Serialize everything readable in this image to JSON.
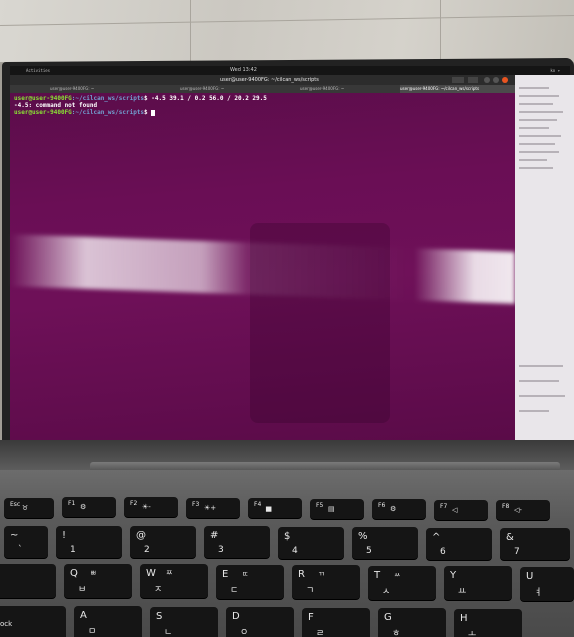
{
  "topbar": {
    "title": "Wed 13:42",
    "indicators": "ko  ▾"
  },
  "window": {
    "title": "user@user-9400FG: ~/cilcan_ws/scripts"
  },
  "tabs": [
    {
      "label": "user@user-9400FG: ~"
    },
    {
      "label": "user@user-9400FG: ~"
    },
    {
      "label": "user@user-9400FG: ~"
    },
    {
      "label": "user@user-9400FG: ~/cilcan_ws/scripts"
    }
  ],
  "terminal": {
    "line1_user": "user@user-9400FG",
    "line1_path": ":~/cilcan_ws/scripts",
    "line1_cmd": "$ -4.5 39.1 / 0.2 56.0 / 20.2 29.5",
    "line2": "-4.5: command not found",
    "line3_user": "user@user-9400FG",
    "line3_path": ":~/cilcan_ws/scripts",
    "line3_cmd": "$ "
  },
  "keyboard": {
    "fkeys": [
      {
        "main": "Esc",
        "sub": "♉"
      },
      {
        "main": "F1",
        "sub": "⚙"
      },
      {
        "main": "F2",
        "sub": "☀-"
      },
      {
        "main": "F3",
        "sub": "☀+"
      },
      {
        "main": "F4",
        "sub": "▅"
      },
      {
        "main": "F5",
        "sub": "▤"
      },
      {
        "main": "F6",
        "sub": "⚙"
      },
      {
        "main": "F7",
        "sub": "◁"
      },
      {
        "main": "F8",
        "sub": "◁-"
      }
    ],
    "numbers": [
      {
        "main": "~",
        "sub": "`"
      },
      {
        "main": "!",
        "sub": "1"
      },
      {
        "main": "@",
        "sub": "2"
      },
      {
        "main": "#",
        "sub": "3"
      },
      {
        "main": "$",
        "sub": "4"
      },
      {
        "main": "%",
        "sub": "5"
      },
      {
        "main": "^",
        "sub": "6"
      },
      {
        "main": "&",
        "sub": "7"
      }
    ],
    "qwerty": [
      {
        "main": "Q",
        "ko": "ㅃ",
        "sub": "ㅂ"
      },
      {
        "main": "W",
        "ko": "ㅉ",
        "sub": "ㅈ"
      },
      {
        "main": "E",
        "ko": "ㄸ",
        "sub": "ㄷ"
      },
      {
        "main": "R",
        "ko": "ㄲ",
        "sub": "ㄱ"
      },
      {
        "main": "T",
        "ko": "ㅆ",
        "sub": "ㅅ"
      },
      {
        "main": "Y",
        "ko": "",
        "sub": "ㅛ"
      },
      {
        "main": "U",
        "ko": "",
        "sub": "ㅕ"
      }
    ],
    "home": [
      {
        "main": "ock",
        "sub": ""
      },
      {
        "main": "A",
        "sub": "ㅁ"
      },
      {
        "main": "S",
        "sub": "ㄴ"
      },
      {
        "main": "D",
        "sub": "ㅇ"
      },
      {
        "main": "F",
        "sub": "ㄹ"
      },
      {
        "main": "G",
        "sub": "ㅎ"
      },
      {
        "main": "H",
        "sub": "ㅗ"
      }
    ]
  }
}
